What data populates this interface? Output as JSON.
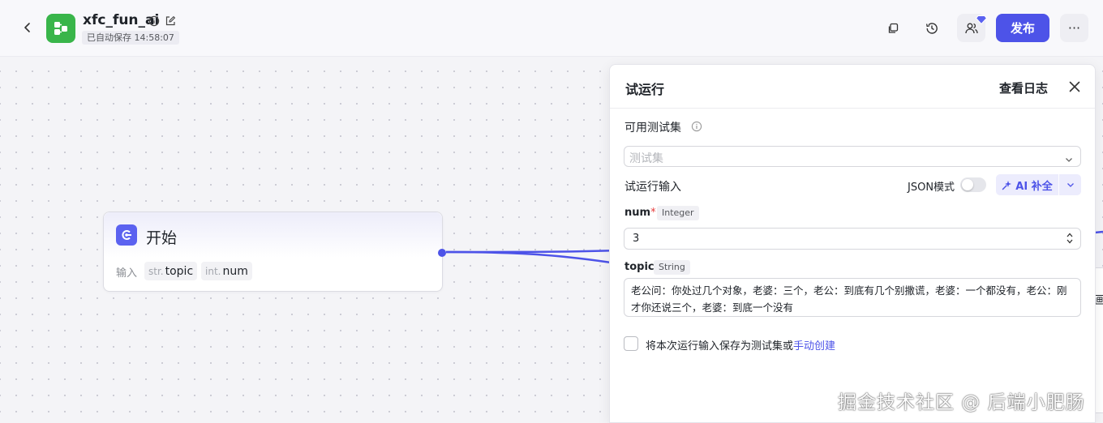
{
  "header": {
    "app_name": "xfc_fun_ai",
    "autosave": "已自动保存 14:58:07",
    "publish_label": "发布",
    "more_label": "···"
  },
  "canvas": {
    "start_node": {
      "title": "开始",
      "inputs_label": "输入",
      "params": [
        {
          "type": "str.",
          "name": "topic"
        },
        {
          "type": "int.",
          "name": "num"
        }
      ]
    },
    "partial_label": "画"
  },
  "test_panel": {
    "title": "试运行",
    "view_log": "查看日志",
    "testset_label": "可用测试集",
    "testset_placeholder": "测试集",
    "run_input_label": "试运行输入",
    "json_mode_label": "JSON模式",
    "json_mode_on": false,
    "ai_complete_label": "AI 补全",
    "fields": [
      {
        "name": "num",
        "required": true,
        "type": "Integer",
        "value": "3"
      },
      {
        "name": "topic",
        "required": false,
        "type": "String",
        "value": "老公问：你处过几个对象，老婆：三个，老公：到底有几个别撒谎，老婆：一个都没有，老公：刚才你还说三个，老婆：到底一个没有"
      }
    ],
    "save_text": "将本次运行输入保存为测试集或",
    "save_link": "手动创建",
    "save_checked": false
  },
  "watermark": "掘金技术社区 @ 后端小肥肠",
  "colors": {
    "accent": "#4d53e8",
    "logo_green": "#39b54a",
    "required_red": "#e63b3b"
  }
}
